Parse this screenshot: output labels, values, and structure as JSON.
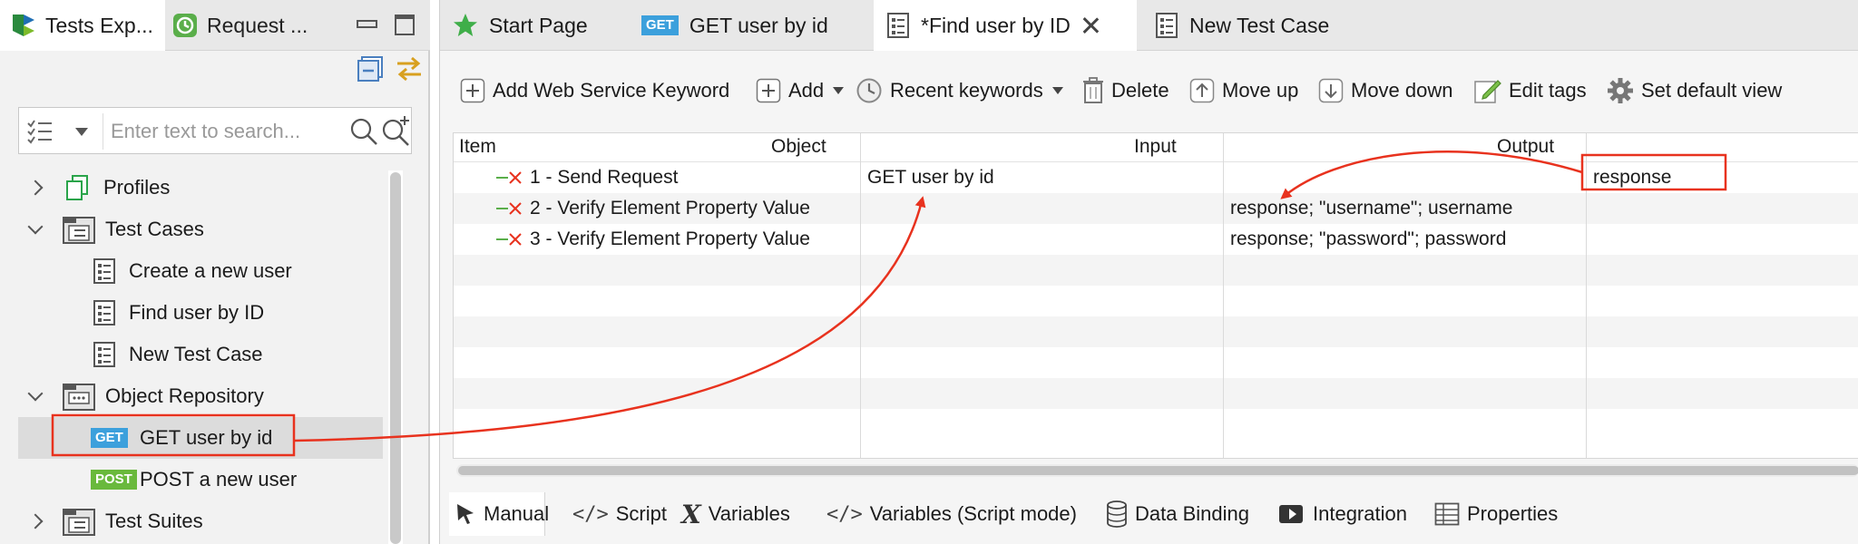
{
  "left_panel": {
    "tabs": [
      {
        "label": "Tests Exp...",
        "icon": "katalon-logo-icon",
        "active": true
      },
      {
        "label": "Request ...",
        "icon": "request-icon",
        "active": false
      }
    ],
    "search_placeholder": "Enter text to search...",
    "tree": [
      {
        "label": "Profiles",
        "icon": "profiles-icon",
        "expanded": false,
        "level": 0
      },
      {
        "label": "Test Cases",
        "icon": "folder-test-cases-icon",
        "expanded": true,
        "level": 0
      },
      {
        "label": "Create a new user",
        "icon": "test-case-icon",
        "level": 1
      },
      {
        "label": "Find user by ID",
        "icon": "test-case-icon",
        "level": 1
      },
      {
        "label": "New Test Case",
        "icon": "test-case-icon",
        "level": 1
      },
      {
        "label": "Object Repository",
        "icon": "folder-object-repository-icon",
        "expanded": true,
        "level": 0
      },
      {
        "label": "GET user by id",
        "badge": "GET",
        "level": 1,
        "selected": true
      },
      {
        "label": "POST a new user",
        "badge": "POST",
        "level": 1
      },
      {
        "label": "Test Suites",
        "icon": "folder-test-suites-icon",
        "expanded": false,
        "level": 0
      }
    ]
  },
  "editor": {
    "tabs": [
      {
        "label": "Start Page",
        "icon": "star-icon"
      },
      {
        "label": "GET user by id",
        "badge": "GET"
      },
      {
        "label": "*Find user by ID",
        "icon": "test-case-icon",
        "active": true,
        "closable": true
      },
      {
        "label": "New Test Case",
        "icon": "test-case-icon"
      }
    ],
    "toolbar": {
      "add_ws_keyword": "Add Web Service Keyword",
      "add": "Add",
      "recent_keywords": "Recent keywords",
      "delete": "Delete",
      "move_up": "Move up",
      "move_down": "Move down",
      "edit_tags": "Edit tags",
      "set_default_view": "Set default view"
    },
    "grid": {
      "columns": [
        "Item",
        "Object",
        "Input",
        "Output"
      ],
      "rows": [
        {
          "item": "1 - Send Request",
          "object": "GET user by id",
          "input": "",
          "output": "response"
        },
        {
          "item": "2 - Verify Element Property Value",
          "object": "",
          "input": "response; \"username\"; username",
          "output": ""
        },
        {
          "item": "3 - Verify Element Property Value",
          "object": "",
          "input": "response; \"password\"; password",
          "output": ""
        }
      ]
    },
    "bottom_tabs": [
      {
        "label": "Manual",
        "icon": "cursor-icon",
        "active": true
      },
      {
        "label": "Script",
        "icon": "code-icon"
      },
      {
        "label": "Variables",
        "icon": "variable-x-icon"
      },
      {
        "label": "Variables (Script mode)",
        "icon": "code-icon"
      },
      {
        "label": "Data Binding",
        "icon": "database-icon"
      },
      {
        "label": "Integration",
        "icon": "integration-icon"
      },
      {
        "label": "Properties",
        "icon": "properties-table-icon"
      }
    ]
  },
  "colors": {
    "annotation_red": "#e8321e",
    "get_badge": "#3ca0dc",
    "post_badge": "#69b93c",
    "selected_row": "#dcdcdc"
  }
}
